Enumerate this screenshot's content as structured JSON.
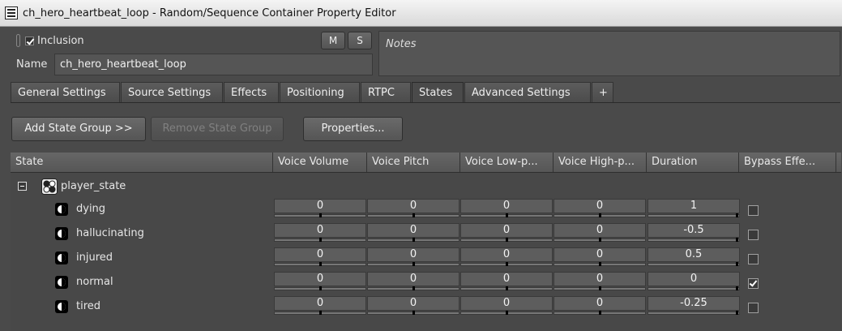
{
  "window": {
    "title": "ch_hero_heartbeat_loop - Random/Sequence Container Property Editor"
  },
  "header": {
    "inclusion_label": "Inclusion",
    "inclusion_checked": true,
    "mute_label": "M",
    "solo_label": "S",
    "name_label": "Name",
    "name_value": "ch_hero_heartbeat_loop",
    "notes_placeholder": "Notes"
  },
  "tabs": [
    {
      "label": "General Settings"
    },
    {
      "label": "Source Settings"
    },
    {
      "label": "Effects"
    },
    {
      "label": "Positioning"
    },
    {
      "label": "RTPC"
    },
    {
      "label": "States",
      "active": true
    },
    {
      "label": "Advanced Settings"
    },
    {
      "label": "+"
    }
  ],
  "toolbar": {
    "add_label": "Add State Group >>",
    "remove_label": "Remove State Group",
    "properties_label": "Properties..."
  },
  "grid": {
    "columns": [
      "State",
      "Voice Volume",
      "Voice Pitch",
      "Voice Low-p...",
      "Voice High-p...",
      "Duration",
      "Bypass Effe..."
    ],
    "state_group": "player_state",
    "states": [
      {
        "name": "dying",
        "values": [
          "0",
          "0",
          "0",
          "0",
          "1"
        ],
        "bypass": false
      },
      {
        "name": "hallucinating",
        "values": [
          "0",
          "0",
          "0",
          "0",
          "-0.5"
        ],
        "bypass": false
      },
      {
        "name": "injured",
        "values": [
          "0",
          "0",
          "0",
          "0",
          "0.5"
        ],
        "bypass": false
      },
      {
        "name": "normal",
        "values": [
          "0",
          "0",
          "0",
          "0",
          "0"
        ],
        "bypass": true
      },
      {
        "name": "tired",
        "values": [
          "0",
          "0",
          "0",
          "0",
          "-0.25"
        ],
        "bypass": false
      }
    ]
  },
  "colors": {
    "background": "#4a4a4a",
    "panel": "#555555",
    "text": "#e6e6e6"
  }
}
